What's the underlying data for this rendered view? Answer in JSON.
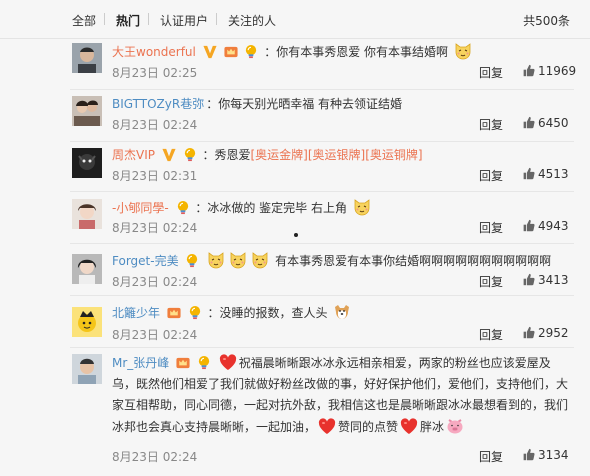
{
  "tabs": [
    "全部",
    "热门",
    "认证用户",
    "关注的人"
  ],
  "total": "共500条",
  "reply_label": "回复",
  "colors": {
    "username": "#eb7350",
    "username_vip": "#4e8cc2",
    "date": "#888888"
  },
  "comments": [
    {
      "user": "大王wonderful",
      "text": "：你有本事秀恩爱 你有本事结婚啊",
      "date": "8月23日 02:25",
      "likes": "11969"
    },
    {
      "user": "BIGTTOZyR巷弥",
      "text": "：你每天别光晒幸福 有种去领证结婚",
      "date": "8月23日 02:24",
      "likes": "6450"
    },
    {
      "user": "周杰VIP",
      "text": "：秀恩爱",
      "links": [
        "[奥运金牌]",
        "[奥运银牌]",
        "[奥运铜牌]"
      ],
      "date": "8月23日 02:31",
      "likes": "4513"
    },
    {
      "user": "-小郇同學-",
      "text": "：冰冰做的 鉴定完毕 右上角",
      "date": "8月23日 02:24",
      "likes": "4943"
    },
    {
      "user": "Forget-完美",
      "text": "有本事秀恩爱有本事你结婚啊啊啊啊啊啊啊啊啊啊啊",
      "date": "8月23日 02:24",
      "likes": "3413"
    },
    {
      "user": "北籬少年",
      "text": "：没睡的报数，查人头",
      "date": "8月23日 02:24",
      "likes": "2952"
    },
    {
      "user": "Mr_张丹峰",
      "text_a": "祝福晨晰晰跟冰冰永远相亲相爱，两家的粉丝也应该爱屋及乌，既然他们相爱了我们就做好粉丝改做的事，好好保护他们，爱他们，支持他们，大家互相帮助，同心同德，一起对抗外敌，我相信这也是晨晰晰跟冰冰最想看到的，我们冰邦也会真心支持晨晰晰，一起加油，",
      "text_b": "赞同的点赞",
      "text_c": "胖冰",
      "date": "8月23日 02:24",
      "likes": "3134"
    }
  ]
}
